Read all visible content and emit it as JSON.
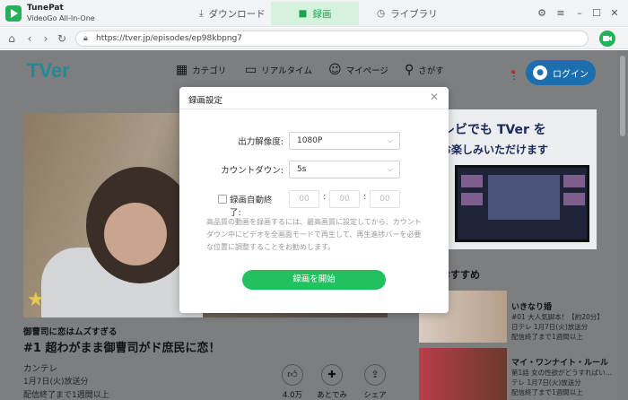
{
  "app": {
    "name": "TunePat",
    "subtitle": "VideoGo All-In-One"
  },
  "mode_tabs": [
    {
      "icon": "download-icon",
      "label": "ダウンロード"
    },
    {
      "icon": "video-camera-icon",
      "label": "録画",
      "active": true
    },
    {
      "icon": "clock-icon",
      "label": "ライブラリ"
    }
  ],
  "browser": {
    "url": "https://tver.jp/episodes/ep98kbpng7"
  },
  "site": {
    "logo": "TVer",
    "nav": [
      {
        "icon": "grid-icon",
        "label": "カテゴリ"
      },
      {
        "icon": "tv-icon",
        "label": "リアルタイム"
      },
      {
        "icon": "person-icon",
        "label": "マイページ"
      },
      {
        "icon": "search-icon",
        "label": "さがす"
      }
    ],
    "login_label": "ログイン",
    "episode": {
      "series": "御曹司に恋はムズすぎる",
      "title": "#1 超わがまま御曹司がド庶民に恋！",
      "channel": "カンテレ",
      "air_date": "1月7日(火)放送分",
      "until": "配信終了まで1週間以上"
    },
    "actions": [
      {
        "icon": "thumbs-up-icon",
        "label": "4.0万"
      },
      {
        "icon": "pin-icon",
        "label": "あとでみる"
      },
      {
        "icon": "share-icon",
        "label": "シェア"
      }
    ],
    "banner": {
      "line1": "テレビでも TVer を",
      "line2": "お楽しみいただけます"
    },
    "recommend_title": "におすすめ",
    "recommend": [
      {
        "title": "いきなり婚",
        "sub1": "#01 大人気脚本！【約20分】",
        "sub2": "日テレ 1月7日(火)放送分",
        "sub3": "配信終了まで1週間以上"
      },
      {
        "title": "マイ・ワンナイト・ルール",
        "sub1": "第1話 女の性欲がどうすればい…",
        "sub2": "テレ 1月7日(火)放送分",
        "sub3": "配信終了まで1週間以上"
      }
    ]
  },
  "dialog": {
    "title": "録画設定",
    "resolution_label": "出力解像度:",
    "resolution_value": "1080P",
    "countdown_label": "カウントダウン:",
    "countdown_value": "5s",
    "autoend_label": "録画自動終了:",
    "time": [
      "00",
      "00",
      "00"
    ],
    "note": "高品質の動画を録画するには、最高画質に設定してから、カウントダウン中にビデオを全画面モードで再生して、再生進捗バーを必要な位置に調整することをお勧めします。",
    "start_label": "録画を開始"
  },
  "colors": {
    "accent": "#22c160",
    "login": "#1b6fae",
    "brand": "#22b25a"
  }
}
